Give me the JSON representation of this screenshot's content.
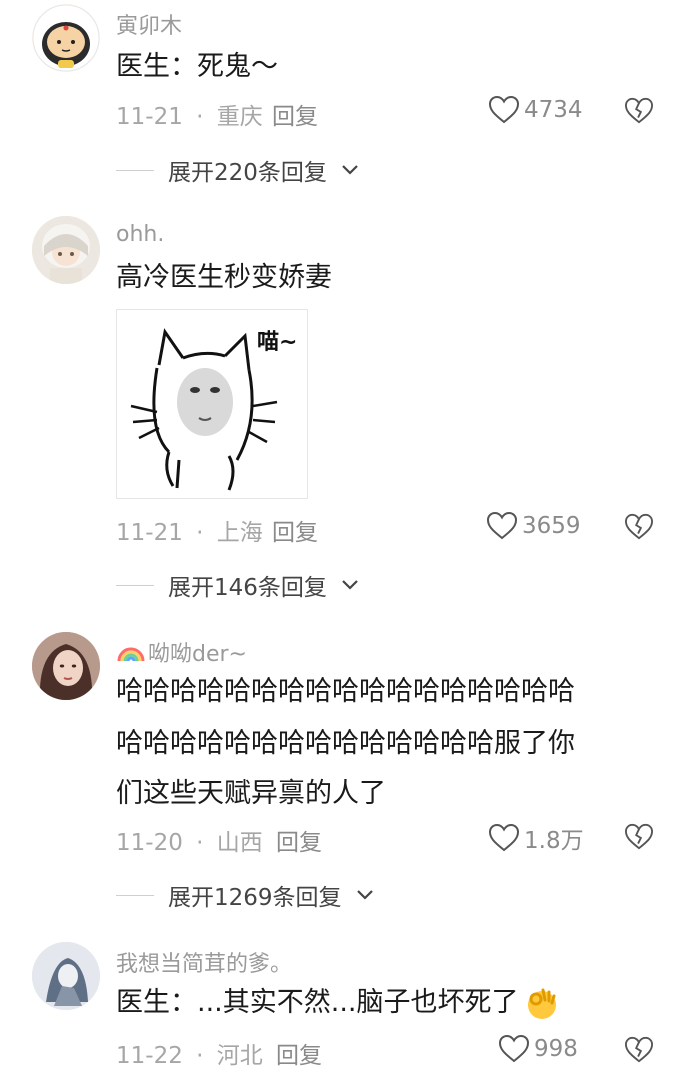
{
  "comments": [
    {
      "username": "寅卯木",
      "text_lines": [
        "医生：死鬼～"
      ],
      "date": "11-21",
      "location": "重庆",
      "reply_label": "回复",
      "likes": "4734",
      "expand_label": "展开220条回复"
    },
    {
      "username": "ohh.",
      "text_lines": [
        "高冷医生秒变娇妻"
      ],
      "sticker_text": "喵~",
      "date": "11-21",
      "location": "上海",
      "reply_label": "回复",
      "likes": "3659",
      "expand_label": "展开146条回复"
    },
    {
      "username": "呦呦der~",
      "username_icon": "rainbow-icon",
      "text_lines": [
        "哈哈哈哈哈哈哈哈哈哈哈哈哈哈哈哈哈",
        "哈哈哈哈哈哈哈哈哈哈哈哈哈哈服了你",
        "们这些天赋异禀的人了"
      ],
      "date": "11-20",
      "location": "山西",
      "reply_label": "回复",
      "likes": "1.8万",
      "expand_label": "展开1269条回复"
    },
    {
      "username": "我想当简茸的爹。",
      "text_lines": [
        "医生：...其实不然...脑子也坏死了"
      ],
      "text_emoji": "ok-hand-emoji",
      "date": "11-22",
      "location": "河北",
      "reply_label": "回复",
      "likes": "998"
    }
  ],
  "separator": "·",
  "colors": {
    "meta": "#a6a6a6",
    "text": "#1a1a1a",
    "icon": "#555555"
  }
}
